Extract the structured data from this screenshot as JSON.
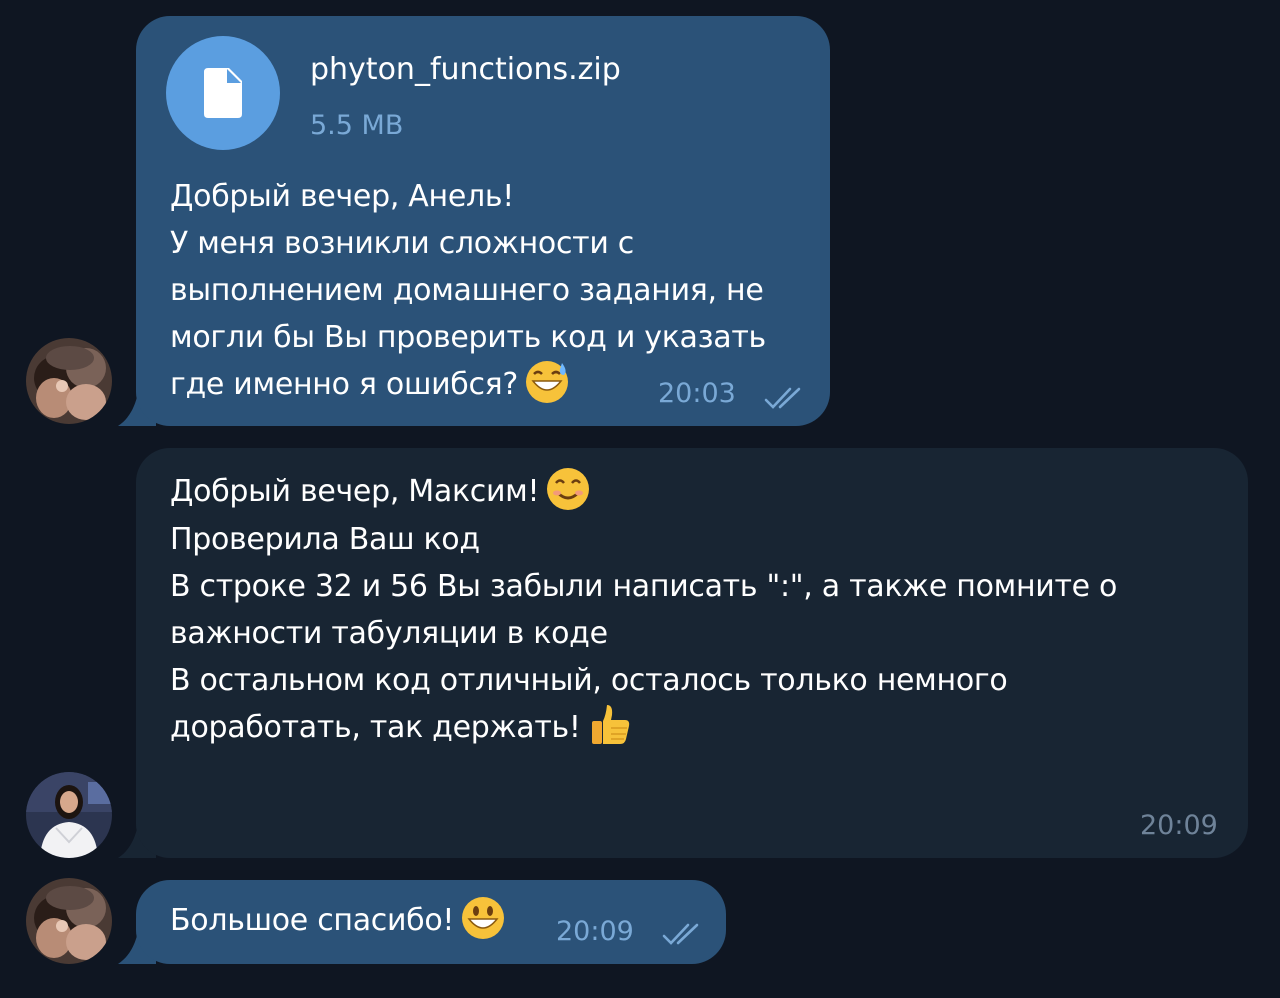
{
  "messages": [
    {
      "direction": "outgoing",
      "file": {
        "name": "phyton_functions.zip",
        "size": "5.5 MB",
        "icon": "document-icon"
      },
      "lines": [
        "Добрый вечер, Анель!",
        "У меня возникли сложности с",
        "выполнением домашнего задания, не",
        "могли бы Вы проверить код и указать",
        "где именно я ошибся?"
      ],
      "emoji": "grinning-sweat-emoji",
      "time": "20:03",
      "status": "read-double-check-icon"
    },
    {
      "direction": "incoming",
      "lines": [
        "Добрый вечер, Максим!",
        "",
        "Проверила Ваш код",
        "В строке 32 и 56 Вы забыли написать \":\", а также помните о",
        "важности табуляции в коде",
        "",
        "В остальном код отличный, осталось только немного",
        "доработать, так держать!"
      ],
      "emoji_line1": "smiling-emoji",
      "emoji_last": "thumbs-up-emoji",
      "time": "20:09"
    },
    {
      "direction": "outgoing",
      "lines": [
        "Большое спасибо!"
      ],
      "emoji": "grinning-emoji",
      "time": "20:09",
      "status": "read-double-check-icon"
    }
  ],
  "colors": {
    "background": "#0f1622",
    "outgoing_bubble": "#2b5278",
    "incoming_bubble": "#182533",
    "file_icon": "#5b9ee0",
    "meta_outgoing": "#7aa9d6",
    "meta_incoming": "#6f8399"
  }
}
